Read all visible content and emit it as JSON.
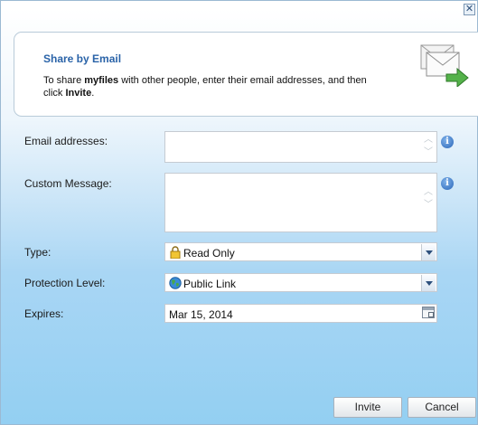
{
  "header": {
    "title": "Share by Email",
    "desc_prefix": "To share ",
    "desc_file": "myfiles",
    "desc_middle": " with other people, enter their email addresses, and then click ",
    "desc_action": "Invite",
    "desc_suffix": "."
  },
  "form": {
    "email_label": "Email addresses:",
    "email_value": "",
    "message_label": "Custom Message:",
    "message_value": "",
    "type_label": "Type:",
    "type_value": "Read Only",
    "protection_label": "Protection Level:",
    "protection_value": "Public Link",
    "expires_label": "Expires:",
    "expires_value": "Mar 15, 2014"
  },
  "buttons": {
    "invite": "Invite",
    "cancel": "Cancel"
  },
  "icons": {
    "close": "close-icon",
    "header": "envelope-icon",
    "info": "info-icon",
    "type": "lock-icon",
    "protection": "globe-icon",
    "calendar": "calendar-icon"
  },
  "colors": {
    "title": "#2a63a8",
    "background_bottom": "#93cff2"
  }
}
